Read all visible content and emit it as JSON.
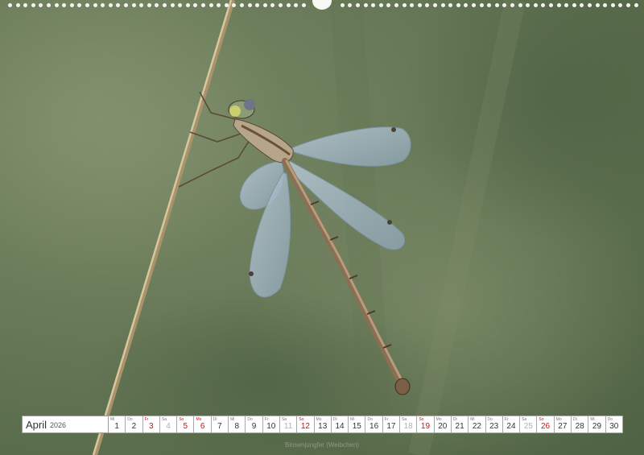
{
  "calendar": {
    "month": "April",
    "year": "2026",
    "days": [
      {
        "n": "1",
        "dow": "Mi",
        "kind": "wd"
      },
      {
        "n": "2",
        "dow": "Do",
        "kind": "wd"
      },
      {
        "n": "3",
        "dow": "Fr",
        "kind": "hol"
      },
      {
        "n": "4",
        "dow": "Sa",
        "kind": "sat"
      },
      {
        "n": "5",
        "dow": "So",
        "kind": "sun"
      },
      {
        "n": "6",
        "dow": "Mo",
        "kind": "hol"
      },
      {
        "n": "7",
        "dow": "Di",
        "kind": "wd"
      },
      {
        "n": "8",
        "dow": "Mi",
        "kind": "wd"
      },
      {
        "n": "9",
        "dow": "Do",
        "kind": "wd"
      },
      {
        "n": "10",
        "dow": "Fr",
        "kind": "wd"
      },
      {
        "n": "11",
        "dow": "Sa",
        "kind": "sat"
      },
      {
        "n": "12",
        "dow": "So",
        "kind": "sun"
      },
      {
        "n": "13",
        "dow": "Mo",
        "kind": "wd"
      },
      {
        "n": "14",
        "dow": "Di",
        "kind": "wd"
      },
      {
        "n": "15",
        "dow": "Mi",
        "kind": "wd"
      },
      {
        "n": "16",
        "dow": "Do",
        "kind": "wd"
      },
      {
        "n": "17",
        "dow": "Fr",
        "kind": "wd"
      },
      {
        "n": "18",
        "dow": "Sa",
        "kind": "sat"
      },
      {
        "n": "19",
        "dow": "So",
        "kind": "sun"
      },
      {
        "n": "20",
        "dow": "Mo",
        "kind": "wd"
      },
      {
        "n": "21",
        "dow": "Di",
        "kind": "wd"
      },
      {
        "n": "22",
        "dow": "Mi",
        "kind": "wd"
      },
      {
        "n": "23",
        "dow": "Do",
        "kind": "wd"
      },
      {
        "n": "24",
        "dow": "Fr",
        "kind": "wd"
      },
      {
        "n": "25",
        "dow": "Sa",
        "kind": "sat"
      },
      {
        "n": "26",
        "dow": "So",
        "kind": "sun"
      },
      {
        "n": "27",
        "dow": "Mo",
        "kind": "wd"
      },
      {
        "n": "28",
        "dow": "Di",
        "kind": "wd"
      },
      {
        "n": "29",
        "dow": "Mi",
        "kind": "wd"
      },
      {
        "n": "30",
        "dow": "Do",
        "kind": "wd"
      }
    ]
  },
  "caption": "Binsenjungfer (Weibchen)",
  "colors": {
    "background": "#6b7c5a",
    "holiday_red": "#cc1111",
    "wing": "#9fb4c4",
    "stem": "#c9b48a"
  }
}
